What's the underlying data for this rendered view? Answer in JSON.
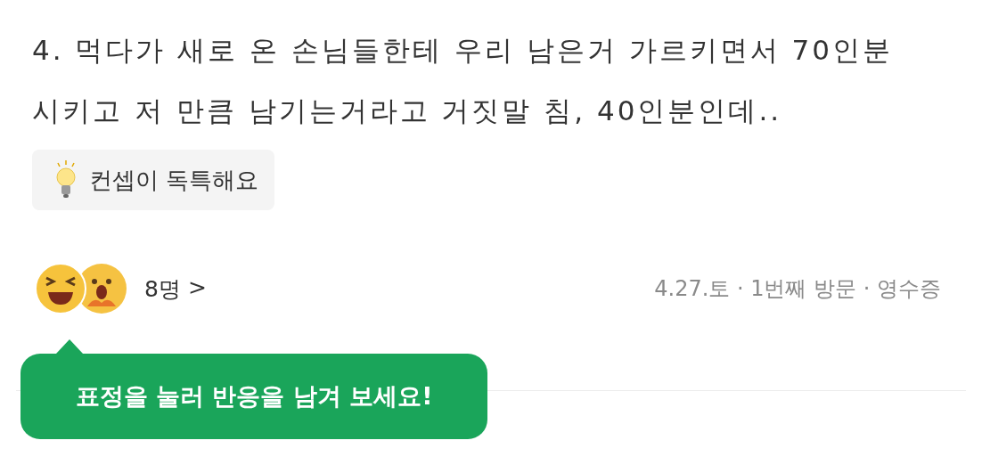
{
  "review": {
    "text": "4. 먹다가 새로 온 손님들한테 우리 남은거 가르키면서 70인분 시키고 저 만큼 남기는거라고 거짓말 침, 40인분인데.."
  },
  "keyword_tag": {
    "label": "컨셉이 독특해요"
  },
  "reactions": {
    "count": "8명",
    "chevron": ">"
  },
  "visit_info": "4.27.토 · 1번째 방문 · 영수증",
  "tooltip": {
    "text": "표정을 눌러 반응을 남겨 보세요!"
  }
}
